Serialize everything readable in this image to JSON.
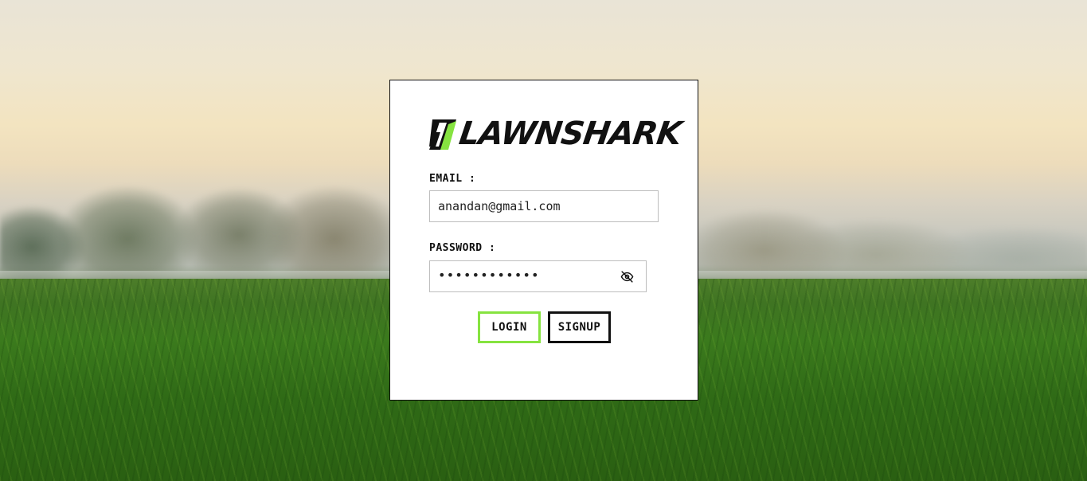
{
  "brand": {
    "name": "LAWNSHARK",
    "accent_color": "#86e340",
    "logo_icon": "lawnshark-logo-icon"
  },
  "form": {
    "email_label": "EMAIL :",
    "email_value": "anandan@gmail.com",
    "password_label": "PASSWORD :",
    "password_value": "••••••••••••",
    "password_toggle_icon": "eye-slash-icon"
  },
  "buttons": {
    "login_label": "LOGIN",
    "signup_label": "SIGNUP"
  }
}
